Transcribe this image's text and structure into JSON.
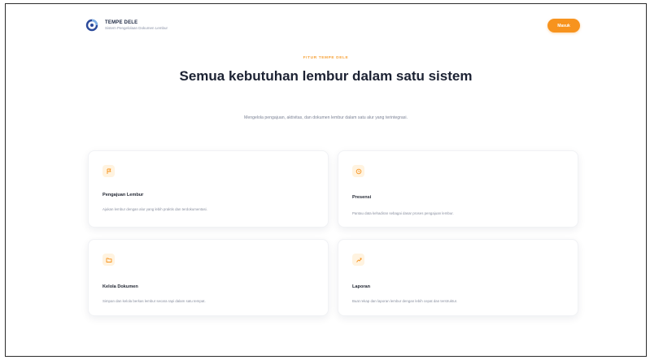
{
  "header": {
    "brand_name": "TEMPE DELE",
    "brand_subtitle": "Sistem Pengelolaan Dokumen Lembur",
    "login_label": "Masuk"
  },
  "hero": {
    "eyebrow": "FITUR TEMPE DELE",
    "title": "Semua kebutuhan lembur dalam satu sistem",
    "subtitle": "Mengelola pengajuan, aktivitas, dan dokumen lembur dalam satu alur yang terintegrasi."
  },
  "features": [
    {
      "title": "Pengajuan Lembur",
      "description": "Ajukan lembur dengan alur yang lebih praktis dan terdokumentasi.",
      "icon": "flag-icon"
    },
    {
      "title": "Presensi",
      "description": "Pantau data kehadiran sebagai dasar proses pengajuan lembur.",
      "icon": "clock-icon"
    },
    {
      "title": "Kelola Dokumen",
      "description": "Simpan dan kelola berkas lembur secara rapi dalam satu tempat.",
      "icon": "folder-icon"
    },
    {
      "title": "Laporan",
      "description": "Buat rekap dan laporan lembur dengan lebih cepat dan terstruktur.",
      "icon": "chart-icon"
    }
  ],
  "colors": {
    "accent": "#f7931e",
    "icon_bg": "#fff3e0",
    "heading": "#1c2233"
  }
}
